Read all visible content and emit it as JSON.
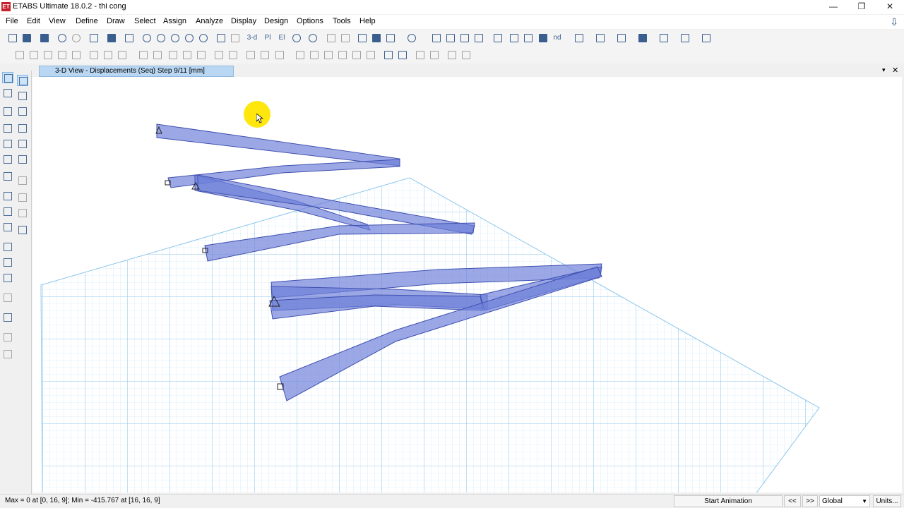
{
  "window": {
    "app_icon": "ET",
    "title": "ETABS Ultimate 18.0.2 - thi cong",
    "minimize": "—",
    "restore": "❐",
    "close": "✕"
  },
  "menu": [
    "File",
    "Edit",
    "View",
    "Define",
    "Draw",
    "Select",
    "Assign",
    "Analyze",
    "Display",
    "Design",
    "Options",
    "Tools",
    "Help"
  ],
  "toolbar": {
    "view_3d_label": "3-d",
    "plan_label": "Pl",
    "elev_label": "El",
    "nd_label": "nd"
  },
  "tab": {
    "title": "3-D View   - Displacements (Seq)  Step 9/11  [mm]",
    "dropdown_glyph": "▾",
    "close_glyph": "✕"
  },
  "status": {
    "text": "Max = 0 at [0, 16, 9];  Min = -415.767 at [16, 16, 9]",
    "animation_button": "Start Animation",
    "prev": "<<",
    "next": ">>",
    "coord_system": "Global",
    "units_button": "Units..."
  },
  "colors": {
    "grid": "#9fd0f0",
    "beam_fill": "#6d7fd9",
    "beam_edge": "#4050b0",
    "cursor_highlight": "#ffe600",
    "tab_active": "#b9d6f2"
  },
  "icons": [
    "new-model-icon",
    "open-icon",
    "save-icon",
    "undo-icon",
    "redo-icon",
    "paint-icon",
    "lock-icon",
    "run-analysis-icon",
    "zoom-icon",
    "pan-icon",
    "rotate-icon",
    "move-up-icon",
    "move-down-icon",
    "pointer-icon",
    "draw-frame-icon"
  ]
}
